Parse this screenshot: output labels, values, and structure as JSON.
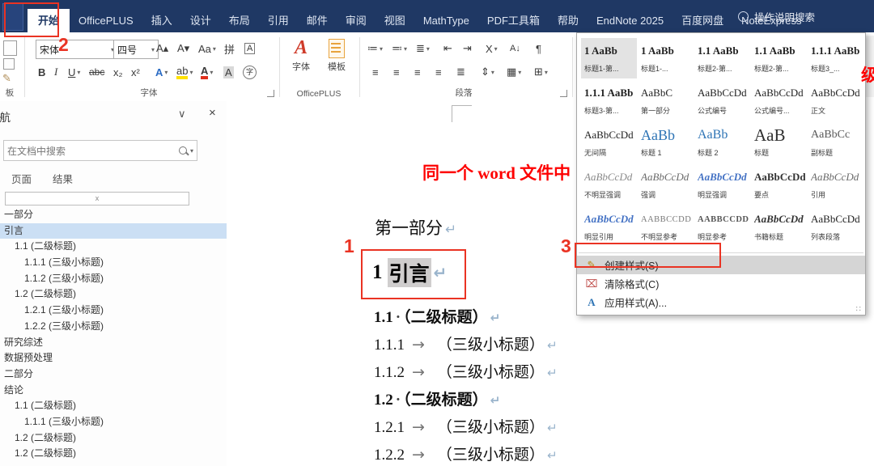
{
  "titlebar": {
    "tabs": [
      "开始",
      "OfficePLUS",
      "插入",
      "设计",
      "布局",
      "引用",
      "邮件",
      "审阅",
      "视图",
      "MathType",
      "PDF工具箱",
      "帮助",
      "EndNote 2025",
      "百度网盘",
      "NoteExpress"
    ],
    "search_label": "操作说明搜索"
  },
  "ribbon": {
    "clipboard_label": "板",
    "font_group": {
      "label": "字体",
      "font_name": "宋体",
      "font_size": "四号"
    },
    "officeplus_group": {
      "label": "OfficePLUS",
      "font_button": "字体",
      "template_button": "模板"
    },
    "paragraph_group": {
      "label": "段落"
    }
  },
  "icons": {
    "grow_font": "A▴",
    "shrink_font": "A▾",
    "change_case": "Aa",
    "phonetic_guide": "拼",
    "character_border": "A",
    "bold": "B",
    "italic": "I",
    "underline": "U",
    "strikethrough": "abc",
    "subscript": "x₂",
    "superscript": "x²",
    "text_effects": "A",
    "highlight": "ab",
    "font_color": "A",
    "character_shading": "A",
    "enclose_character": "字",
    "bullets": "≔",
    "numbering": "≕",
    "multilevel": "≣",
    "outdent": "⇤",
    "indent": "⇥",
    "asian_layout": "X",
    "sort": "A↓",
    "show_marks": "¶",
    "align_left": "≡",
    "align_center": "≡",
    "align_right": "≡",
    "justify": "≡",
    "distribute": "≣",
    "line_spacing": "⇕",
    "shading_fill": "▦",
    "borders": "⊞",
    "format_painter": "✎",
    "paste": "",
    "copy": "",
    "create_style_icon": "✎",
    "clear_format_icon": "⌧",
    "apply_styles_icon": "A",
    "pane_collapse": "∨",
    "pane_close": "×",
    "resize_grip": "∷"
  },
  "styles_menu": {
    "items": [
      {
        "preview": "1 AaBb",
        "label": "标题1-第..."
      },
      {
        "preview": "1 AaBb",
        "label": "标题1-..."
      },
      {
        "preview": "1.1 AaBb",
        "label": "标题2-第..."
      },
      {
        "preview": "1.1 AaBb",
        "label": "标题2-第..."
      },
      {
        "preview": "1.1.1 AaBb",
        "label": "标题3_..."
      },
      {
        "preview": "1.1.1 AaBb",
        "label": "标题3-第..."
      },
      {
        "preview": "AaBbC",
        "label": "第一部分"
      },
      {
        "preview": "AaBbCcDd",
        "label": "公式编号"
      },
      {
        "preview": "AaBbCcDd",
        "label": "公式编号..."
      },
      {
        "preview": "AaBbCcDd",
        "label": "正文"
      },
      {
        "preview": "AaBbCcDd",
        "label": "无间隔"
      },
      {
        "preview": "AaBb",
        "label": "标题 1"
      },
      {
        "preview": "AaBb",
        "label": "标题 2"
      },
      {
        "preview": "AaB",
        "label": "标题"
      },
      {
        "preview": "AaBbCc",
        "label": "副标题"
      },
      {
        "preview": "AaBbCcDd",
        "label": "不明显强调"
      },
      {
        "preview": "AaBbCcDd",
        "label": "强调"
      },
      {
        "preview": "AaBbCcDd",
        "label": "明显强调"
      },
      {
        "preview": "AaBbCcDd",
        "label": "要点"
      },
      {
        "preview": "AaBbCcDd",
        "label": "引用"
      },
      {
        "preview": "AaBbCcDd",
        "label": "明显引用"
      },
      {
        "preview": "AABBCCDD",
        "label": "不明显参考"
      },
      {
        "preview": "AABBCCDD",
        "label": "明显参考"
      },
      {
        "preview": "AaBbCcDd",
        "label": "书籍标题"
      },
      {
        "preview": "AaBbCcDd",
        "label": "列表段落"
      }
    ],
    "commands": [
      {
        "label": "创建样式(S)"
      },
      {
        "label": "清除格式(C)"
      },
      {
        "label": "应用样式(A)..."
      }
    ]
  },
  "navpane": {
    "title": "导航",
    "search_placeholder": "在文档中搜索",
    "filter_mark": "x",
    "tabs": [
      "页面",
      "结果"
    ],
    "items": [
      {
        "text": "一部分",
        "level": 0
      },
      {
        "text": "引言",
        "level": 0
      },
      {
        "text": "1.1 (二级标题)",
        "level": 1
      },
      {
        "text": "1.1.1 (三级小标题)",
        "level": 2
      },
      {
        "text": "1.1.2 (三级小标题)",
        "level": 2
      },
      {
        "text": "1.2 (二级标题)",
        "level": 1
      },
      {
        "text": "1.2.1 (三级小标题)",
        "level": 2
      },
      {
        "text": "1.2.2 (三级小标题)",
        "level": 2
      },
      {
        "text": "研究综述",
        "level": 0
      },
      {
        "text": "数据预处理",
        "level": 0
      },
      {
        "text": "二部分",
        "level": 0
      },
      {
        "text": "结论",
        "level": 0
      },
      {
        "text": "1.1 (二级标题)",
        "level": 1
      },
      {
        "text": "1.1.1 (三级小标题)",
        "level": 2
      },
      {
        "text": "1.2 (二级标题)",
        "level": 1
      },
      {
        "text": "1.2 (二级标题)",
        "level": 1
      }
    ]
  },
  "document": {
    "red_title": "同一个 word 文件中",
    "red_title_tail": "级",
    "part_heading": "第一部分",
    "boxed_heading": {
      "num": "1",
      "text": "引言"
    },
    "lines": [
      {
        "num": "1.1",
        "text": "（二级标题）",
        "style": "bold"
      },
      {
        "num": "1.1.1",
        "text": "（三级小标题）",
        "style": "tab"
      },
      {
        "num": "1.1.2",
        "text": "（三级小标题）",
        "style": "tab"
      },
      {
        "num": "1.2",
        "text": "（二级标题）",
        "style": "bold"
      },
      {
        "num": "1.2.1",
        "text": "（三级小标题）",
        "style": "tab"
      },
      {
        "num": "1.2.2",
        "text": "（三级小标题）",
        "style": "tab"
      }
    ],
    "marks": {
      "pilcrow": "↵",
      "tab": "→",
      "dot": "·"
    }
  },
  "annotations": {
    "step1": "1",
    "step2": "2",
    "step3": "3"
  }
}
